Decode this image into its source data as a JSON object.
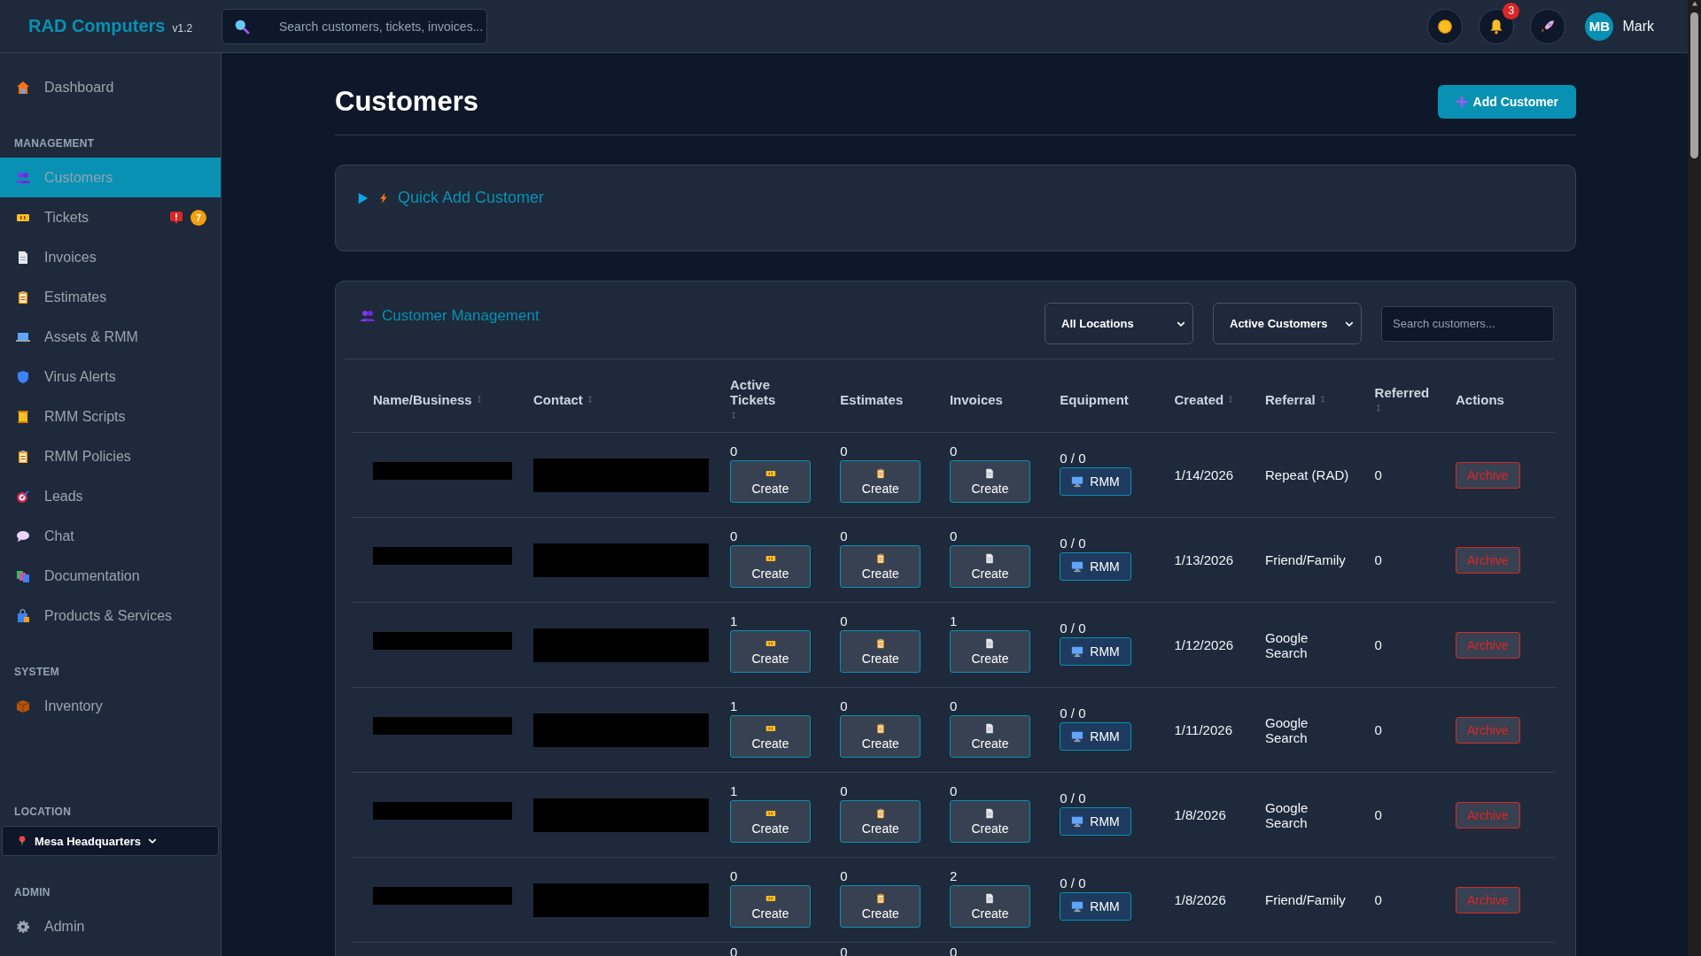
{
  "topbar": {
    "brand": "RAD Computers",
    "version": "v1.2",
    "search": {
      "placeholder": "Search customers, tickets, invoices..."
    },
    "notifications": "3",
    "user": {
      "initials": "MB",
      "name": "Mark"
    }
  },
  "sidebar": {
    "sections": [
      {
        "kind": "nav",
        "items": [
          {
            "label": "Dashboard",
            "selected": false
          }
        ]
      },
      {
        "kind": "nav",
        "title": "MANAGEMENT",
        "items": [
          {
            "label": "Customers",
            "selected": true
          },
          {
            "label": "Tickets",
            "selected": false,
            "alert": true,
            "count": "7"
          },
          {
            "label": "Invoices",
            "selected": false
          },
          {
            "label": "Estimates",
            "selected": false
          },
          {
            "label": "Assets & RMM",
            "selected": false
          },
          {
            "label": "Virus Alerts",
            "selected": false
          },
          {
            "label": "RMM Scripts",
            "selected": false
          },
          {
            "label": "RMM Policies",
            "selected": false
          },
          {
            "label": "Leads",
            "selected": false
          },
          {
            "label": "Chat",
            "selected": false
          },
          {
            "label": "Documentation",
            "selected": false
          },
          {
            "label": "Products & Services",
            "selected": false
          }
        ]
      },
      {
        "kind": "nav",
        "title": "SYSTEM",
        "items": [
          {
            "label": "Inventory",
            "selected": false
          }
        ]
      },
      {
        "kind": "location",
        "title": "LOCATION",
        "value": "Mesa Headquarters"
      },
      {
        "kind": "nav",
        "title": "ADMIN",
        "items": [
          {
            "label": "Admin",
            "selected": false
          }
        ]
      }
    ]
  },
  "page": {
    "title": "Customers",
    "add_button": "Add Customer"
  },
  "quick_add": {
    "title": "Quick Add Customer",
    "expanded": false
  },
  "management": {
    "title": "Customer Management",
    "location_filter": "All Locations",
    "status_filter": "Active Customers",
    "search": {
      "placeholder": "Search customers..."
    },
    "table": {
      "columns": [
        {
          "label": "Name/Business",
          "sortable": true
        },
        {
          "label": "Contact",
          "sortable": true
        },
        {
          "label": "Active Tickets",
          "sortable": true
        },
        {
          "label": "Estimates",
          "sortable": false
        },
        {
          "label": "Invoices",
          "sortable": false
        },
        {
          "label": "Equipment",
          "sortable": false
        },
        {
          "label": "Created",
          "sortable": true
        },
        {
          "label": "Referral",
          "sortable": true
        },
        {
          "label": "Referred",
          "sortable": true
        },
        {
          "label": "Actions",
          "sortable": false
        }
      ],
      "rows": [
        {
          "name_redacted": true,
          "contact_redacted": true,
          "tickets": "0",
          "tickets_button": "Create",
          "estimates": "0",
          "estimates_button": "Create",
          "invoices": "0",
          "invoices_button": "Create",
          "equipment": "0 / 0",
          "rmm_button": "RMM",
          "created": "1/14/2026",
          "referral": "Repeat (RAD)",
          "referred": "0",
          "action": "Archive"
        },
        {
          "name_redacted": true,
          "contact_redacted": true,
          "tickets": "0",
          "tickets_button": "Create",
          "estimates": "0",
          "estimates_button": "Create",
          "invoices": "0",
          "invoices_button": "Create",
          "equipment": "0 / 0",
          "rmm_button": "RMM",
          "created": "1/13/2026",
          "referral": "Friend/Family",
          "referred": "0",
          "action": "Archive"
        },
        {
          "name_redacted": true,
          "contact_redacted": true,
          "tickets": "1",
          "tickets_button": "Create",
          "estimates": "0",
          "estimates_button": "Create",
          "invoices": "1",
          "invoices_button": "Create",
          "equipment": "0 / 0",
          "rmm_button": "RMM",
          "created": "1/12/2026",
          "referral": "Google Search",
          "referred": "0",
          "action": "Archive"
        },
        {
          "name_redacted": true,
          "contact_redacted": true,
          "tickets": "1",
          "tickets_button": "Create",
          "estimates": "0",
          "estimates_button": "Create",
          "invoices": "0",
          "invoices_button": "Create",
          "equipment": "0 / 0",
          "rmm_button": "RMM",
          "created": "1/11/2026",
          "referral": "Google Search",
          "referred": "0",
          "action": "Archive"
        },
        {
          "name_redacted": true,
          "contact_redacted": true,
          "tickets": "1",
          "tickets_button": "Create",
          "estimates": "0",
          "estimates_button": "Create",
          "invoices": "0",
          "invoices_button": "Create",
          "equipment": "0 / 0",
          "rmm_button": "RMM",
          "created": "1/8/2026",
          "referral": "Google Search",
          "referred": "0",
          "action": "Archive"
        },
        {
          "name_redacted": true,
          "contact_redacted": true,
          "tickets": "0",
          "tickets_button": "Create",
          "estimates": "0",
          "estimates_button": "Create",
          "invoices": "2",
          "invoices_button": "Create",
          "equipment": "0 / 0",
          "rmm_button": "RMM",
          "created": "1/8/2026",
          "referral": "Friend/Family",
          "referred": "0",
          "action": "Archive"
        },
        {
          "tickets": "0",
          "estimates": "0",
          "invoices": "0"
        }
      ]
    }
  }
}
